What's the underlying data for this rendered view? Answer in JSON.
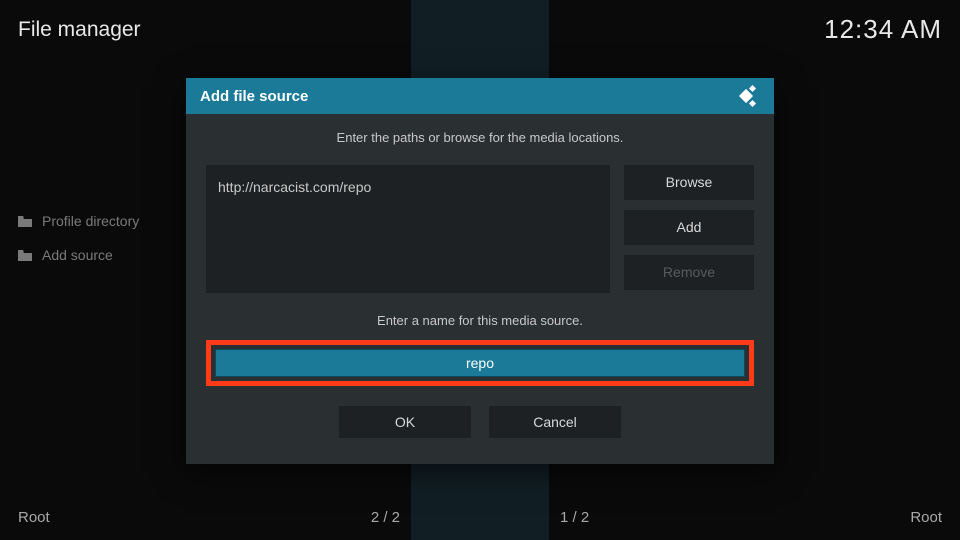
{
  "header": {
    "title": "File manager",
    "clock": "12:34 AM"
  },
  "sidebar": {
    "items": [
      {
        "label": "Profile directory"
      },
      {
        "label": "Add source"
      }
    ]
  },
  "dialog": {
    "title": "Add file source",
    "instruction_paths": "Enter the paths or browse for the media locations.",
    "path_value": "http://narcacist.com/repo",
    "browse_label": "Browse",
    "add_label": "Add",
    "remove_label": "Remove",
    "instruction_name": "Enter a name for this media source.",
    "name_value": "repo",
    "ok_label": "OK",
    "cancel_label": "Cancel"
  },
  "footer": {
    "left_root": "Root",
    "left_counter": "2 / 2",
    "right_counter": "1 / 2",
    "right_root": "Root"
  }
}
